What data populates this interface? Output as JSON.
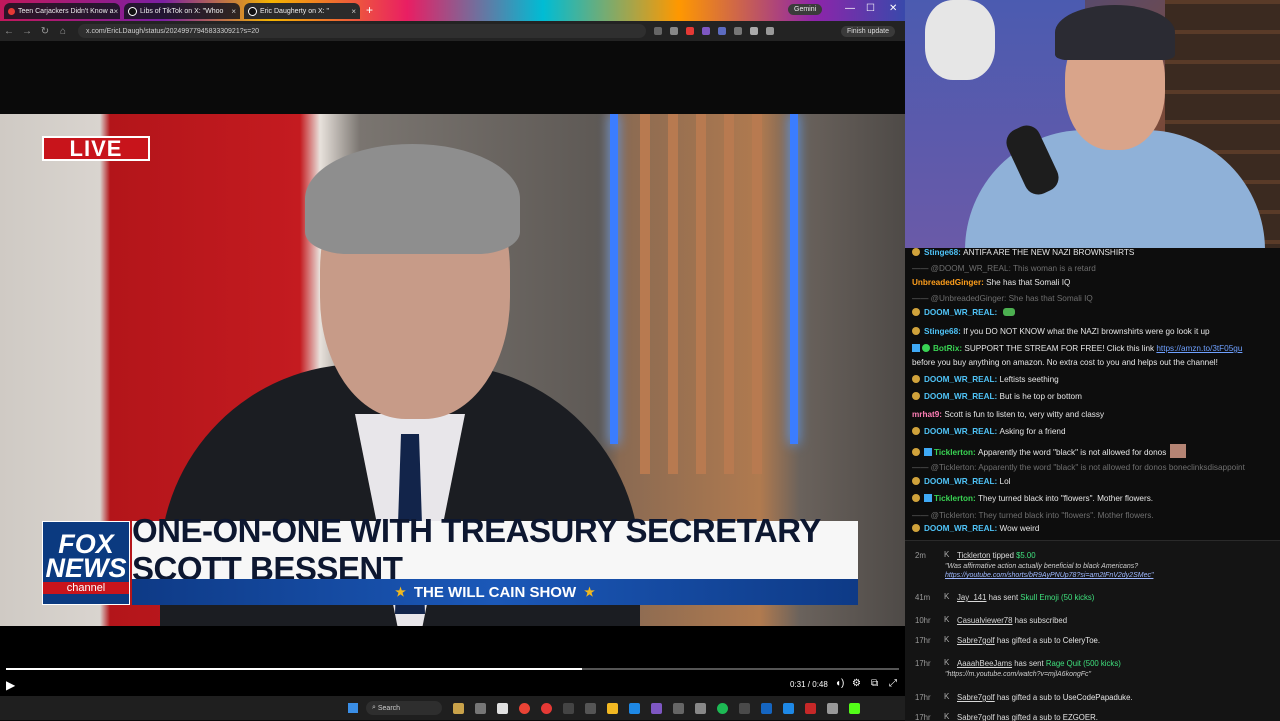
{
  "browser": {
    "tabs": [
      {
        "label": "Teen Carjackers Didn't Know a",
        "active": false
      },
      {
        "label": "Libs of TikTok on X: \"Whoo",
        "active": false
      },
      {
        "label": "Eric Daugherty on X: \"",
        "active": true
      }
    ],
    "new_tab": "+",
    "gemini_label": "Gemini",
    "url": "x.com/EricLDaugh/status/2024997794583330921?s=20",
    "finish_update": "Finish update"
  },
  "video": {
    "live_label": "LIVE",
    "network_top": "FOX",
    "network_mid": "NEWS",
    "network_bottom": "channel",
    "headline": "ONE-ON-ONE WITH TREASURY SECRETARY SCOTT BESSENT",
    "show_name": "THE WILL CAIN SHOW",
    "star": "★",
    "time_display": "0:31 / 0:48",
    "progress": 0.645
  },
  "taskbar": {
    "search_placeholder": "Search"
  },
  "chat": {
    "messages": [
      {
        "user": "Stinge68:",
        "color": "#4fc3f7",
        "text": "ANTIFA ARE THE NEW NAZI BROWNSHIRTS",
        "badge": "coin"
      },
      {
        "reply": "@DOOM_WR_REAL: This woman is a retard"
      },
      {
        "user": "UnbreadedGinger:",
        "color": "#ff9f1c",
        "text": "She has that Somali IQ"
      },
      {
        "reply": "@UnbreadedGinger: She has that Somali IQ"
      },
      {
        "user": "DOOM_WR_REAL:",
        "color": "#4fc3f7",
        "text": "",
        "badge": "coin",
        "emote": true
      },
      {
        "user": "Stinge68:",
        "color": "#4fc3f7",
        "text": "If you DO NOT KNOW what the NAZI brownshirts were go look it up",
        "badge": "coin"
      },
      {
        "user": "BotRix:",
        "color": "#39d353",
        "text": "SUPPORT THE STREAM FOR FREE! Click this link ",
        "link": "https://amzn.to/3tF05gu",
        "badge": "bot"
      },
      {
        "text": "before you buy anything on amazon. No extra cost to you and helps out the channel!"
      },
      {
        "user": "DOOM_WR_REAL:",
        "color": "#4fc3f7",
        "text": "Leftists seething",
        "badge": "coin"
      },
      {
        "user": "DOOM_WR_REAL:",
        "color": "#4fc3f7",
        "text": "But is he top or bottom",
        "badge": "coin"
      },
      {
        "user": "mrhat9:",
        "color": "#ff7eb6",
        "text": "Scott is fun to listen to, very witty and classy"
      },
      {
        "user": "DOOM_WR_REAL:",
        "color": "#4fc3f7",
        "text": "Asking for a friend",
        "badge": "coin"
      },
      {
        "user": "Ticklerton:",
        "color": "#39d353",
        "text": "Apparently the word \"black\" is not allowed for donos",
        "badge": "coin2",
        "emote2": true
      },
      {
        "reply": "@Ticklerton: Apparently the word \"black\" is not allowed for donos boneclinksdisappoint"
      },
      {
        "user": "DOOM_WR_REAL:",
        "color": "#4fc3f7",
        "text": "Lol",
        "badge": "coin"
      },
      {
        "user": "Ticklerton:",
        "color": "#39d353",
        "text": "They turned black into \"flowers\". Mother flowers.",
        "badge": "coin2"
      },
      {
        "reply": "@Ticklerton: They turned black into \"flowers\". Mother flowers."
      },
      {
        "user": "DOOM_WR_REAL:",
        "color": "#4fc3f7",
        "text": "Wow weird",
        "badge": "coin"
      }
    ]
  },
  "feed": {
    "rows": [
      {
        "time": "2m",
        "name": "Ticklerton",
        "action": "tipped",
        "highlight": "$5.00",
        "sub1": "\"Was affirmative action actually beneficial to black Americans?",
        "sub2": "https://youtube.com/shorts/bR9AyPNUp78?si=am2tFnV2dy2SMec\""
      },
      {
        "time": "41m",
        "name": "Jay_141",
        "action": "has sent",
        "highlight": "Skull Emoji (50 kicks)"
      },
      {
        "time": "10hr",
        "name": "Casualviewer78",
        "action": "has subscribed"
      },
      {
        "time": "17hr",
        "name": "Sabre7golf",
        "action": "has gifted a sub to",
        "highlight2": "CeleryToe."
      },
      {
        "time": "17hr",
        "name": "AaaahBeeJams",
        "action": "has sent",
        "highlight": "Rage Quit (500 kicks)",
        "sub1": "\"https://m.youtube.com/watch?v=mjlA6kongFc\""
      },
      {
        "time": "17hr",
        "name": "Sabre7golf",
        "action": "has gifted a sub to",
        "highlight2": "UseCodePapaduke."
      },
      {
        "time": "17hr",
        "name": "Sabre7golf",
        "action": "has gifted a sub to",
        "highlight2": "EZGOER."
      }
    ]
  },
  "icons": {
    "play": "▶",
    "volume": "🔊",
    "settings": "⚙",
    "pip": "⧉",
    "fullscreen": "⤢",
    "close": "✕",
    "minimize": "—",
    "maximize": "☐"
  }
}
